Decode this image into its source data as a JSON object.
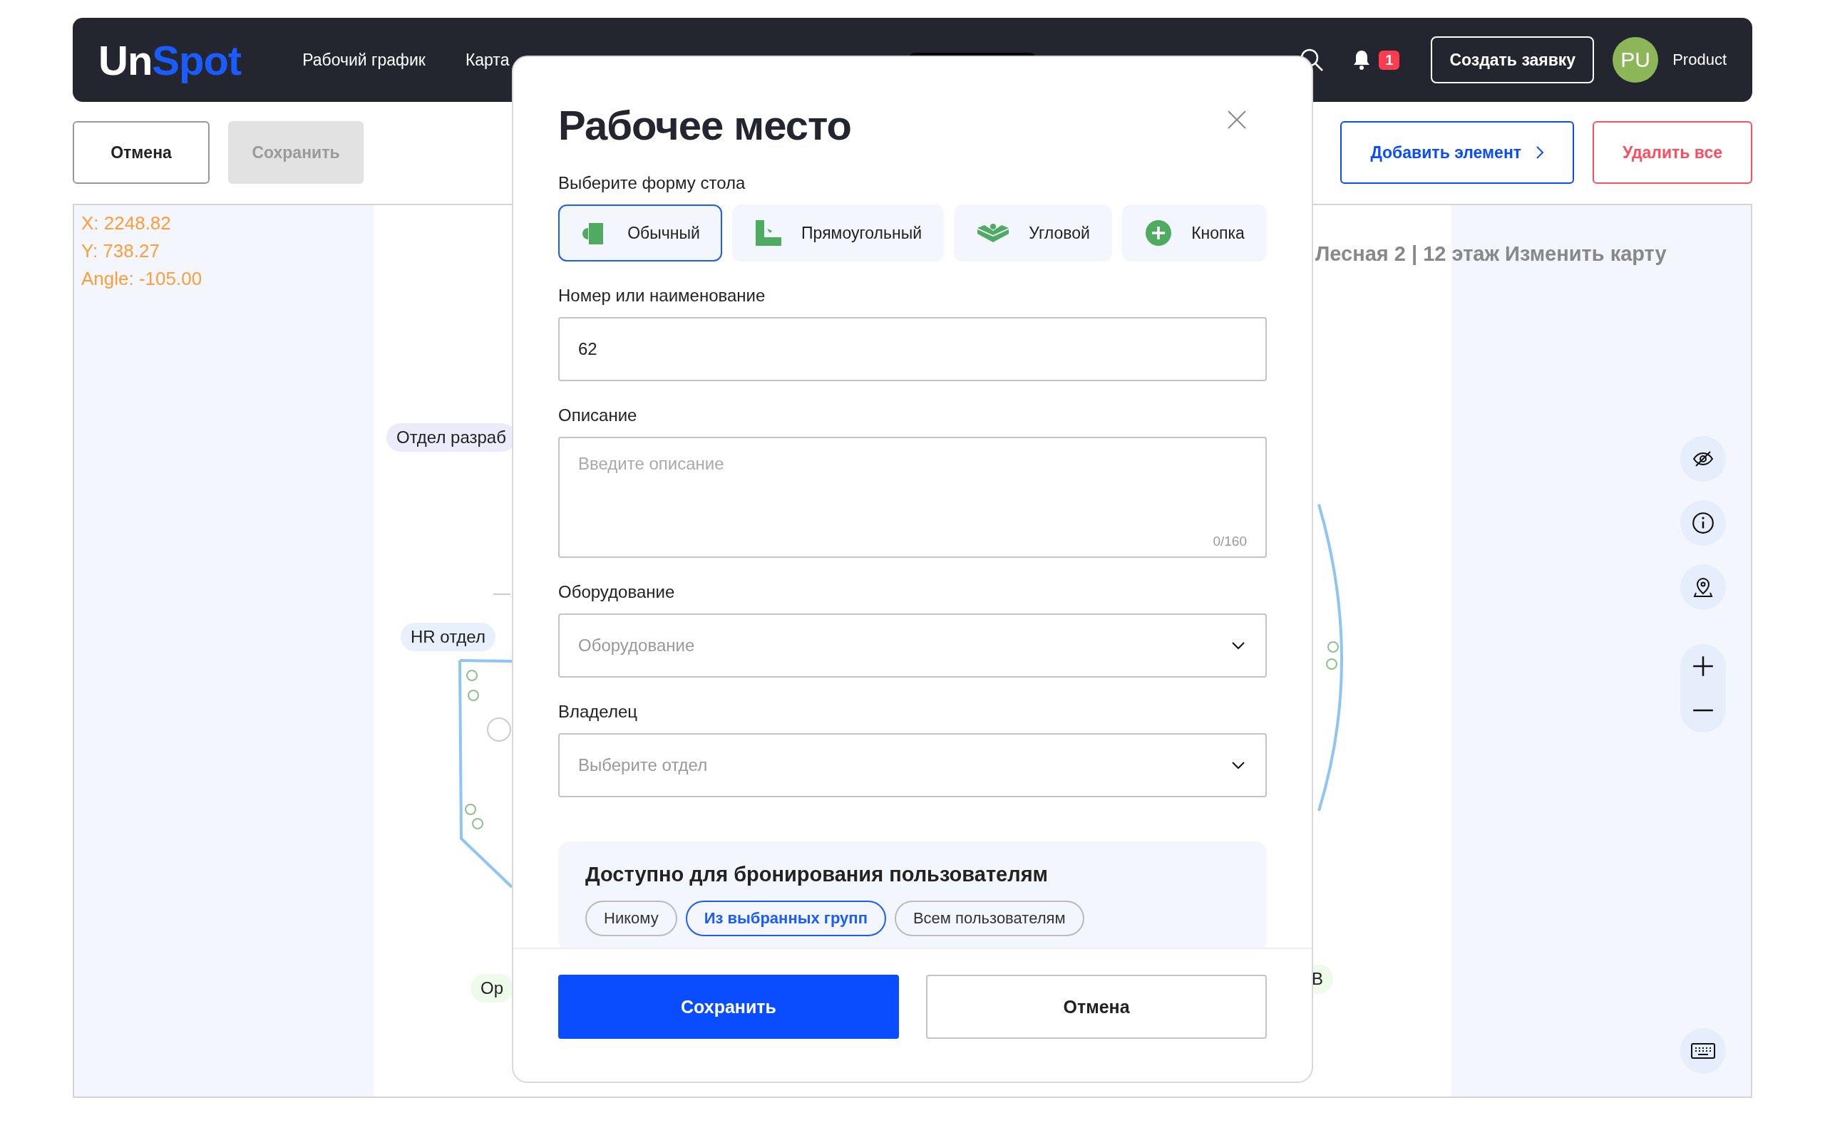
{
  "header": {
    "logo": {
      "part_1": "Un",
      "part_2": "Spot"
    },
    "nav": [
      {
        "label": "Рабочий график"
      },
      {
        "label": "Карта"
      }
    ],
    "notifications_badge": "1",
    "create_button": "Создать заявку",
    "avatar": "PU",
    "user_name": "Product"
  },
  "toolbar": {
    "cancel": "Отмена",
    "save": {
      "label": "Сохранить",
      "disabled": true
    },
    "add_element": "Добавить элемент",
    "delete_all": "Удалить все"
  },
  "map": {
    "coordinates": [
      "X: 2248.82",
      "Y: 738.27",
      "Angle: -105.00"
    ],
    "title": "Лесная 2 | 12 этаж Изменить карту",
    "labels": [
      {
        "text": "Отдел разраб",
        "color": "#ebebfb"
      },
      {
        "text": "HR отдел",
        "color": "#e8f0fb"
      },
      {
        "text": "Ор",
        "color": "#eefaea"
      },
      {
        "text": "В",
        "color": "#eefaea"
      }
    ]
  },
  "modal": {
    "title": "Рабочее место",
    "shape_label": "Выберите форму стола",
    "shapes": [
      {
        "label": "Обычный",
        "kind": "regular",
        "selected": true
      },
      {
        "label": "Прямоугольный",
        "kind": "rectangular",
        "selected": false
      },
      {
        "label": "Угловой",
        "kind": "corner",
        "selected": false
      },
      {
        "label": "Кнопка",
        "kind": "button",
        "selected": false
      }
    ],
    "fields": [
      {
        "label": "Номер или наименование",
        "kind": "input",
        "value": "62"
      },
      {
        "label": "Описание",
        "kind": "textarea",
        "placeholder": "Введите описание",
        "counter": "0/160"
      },
      {
        "label": "Оборудование",
        "kind": "select",
        "placeholder": "Оборудование"
      },
      {
        "label": "Владелец",
        "kind": "select",
        "placeholder": "Выберите отдел"
      }
    ],
    "availability": {
      "title": "Доступно для бронирования пользователям",
      "options": [
        {
          "label": "Никому",
          "selected": false
        },
        {
          "label": "Из выбранных групп",
          "selected": true
        },
        {
          "label": "Всем пользователям",
          "selected": false
        }
      ]
    },
    "buttons": {
      "save": "Сохранить",
      "cancel": "Отмена"
    }
  }
}
